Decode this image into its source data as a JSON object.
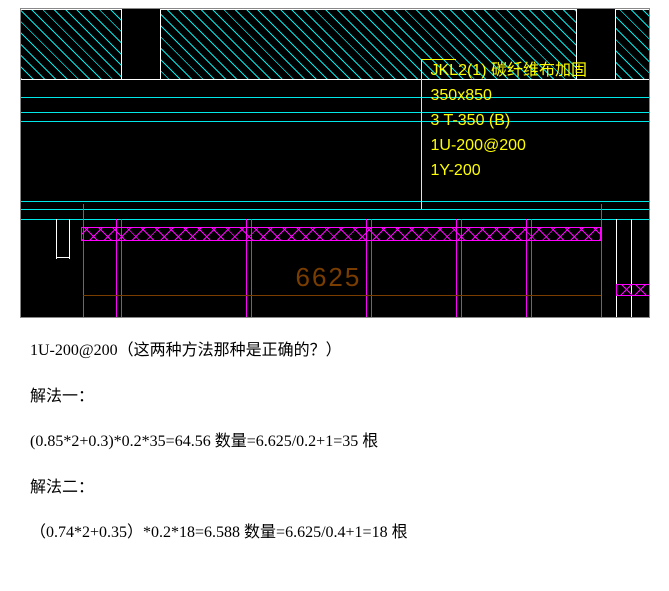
{
  "cad": {
    "annotations": {
      "line1": "JKL2(1)  碳纤维布加固",
      "line2": "350x850",
      "line3": "3 T-350 (B)",
      "line4": "1U-200@200",
      "line5": "1Y-200"
    },
    "dimension": "6625"
  },
  "document": {
    "question": "1U-200@200（这两种方法那种是正确的？）",
    "sol1_label": "解法一：",
    "sol1_calc": "(0.85*2+0.3)*0.2*35=64.56  数量=6.625/0.2+1=35 根",
    "sol2_label": "解法二：",
    "sol2_calc": "（0.74*2+0.35）*0.2*18=6.588    数量=6.625/0.4+1=18 根"
  }
}
